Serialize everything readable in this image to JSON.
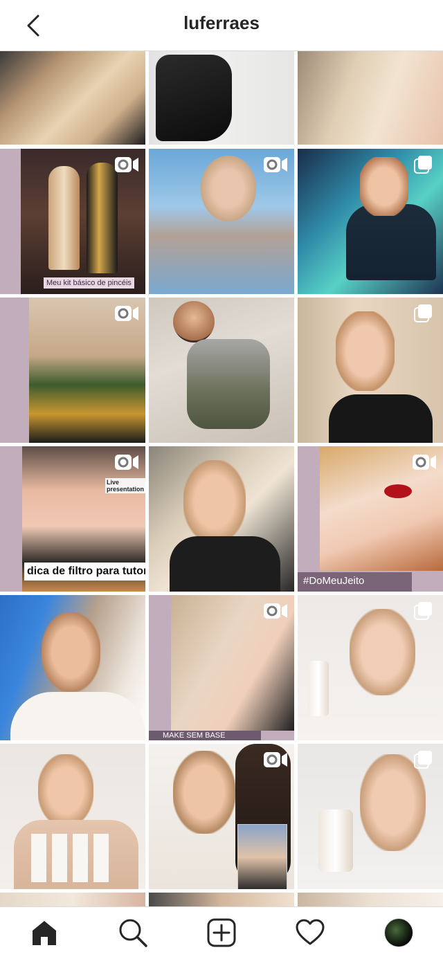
{
  "header": {
    "title": "luferraes"
  },
  "overlays": {
    "kit_caption": "Meu kit básico de pincéis",
    "live_caption": "Live presentation",
    "filter_caption": "dica de filtro para tutori",
    "hashtag_caption": "#DoMeuJeito",
    "make_caption": "MAKE SEM BASE"
  },
  "badges": {
    "video": "video-camera-icon",
    "carousel": "multiple-photos-icon"
  },
  "tabs": [
    "home-icon",
    "search-icon",
    "new-post-icon",
    "activity-icon",
    "profile-avatar"
  ],
  "colors": {
    "text": "#262626",
    "border": "#dbdbdb",
    "background": "#ffffff",
    "accent_lilac": "#c2adbd"
  }
}
